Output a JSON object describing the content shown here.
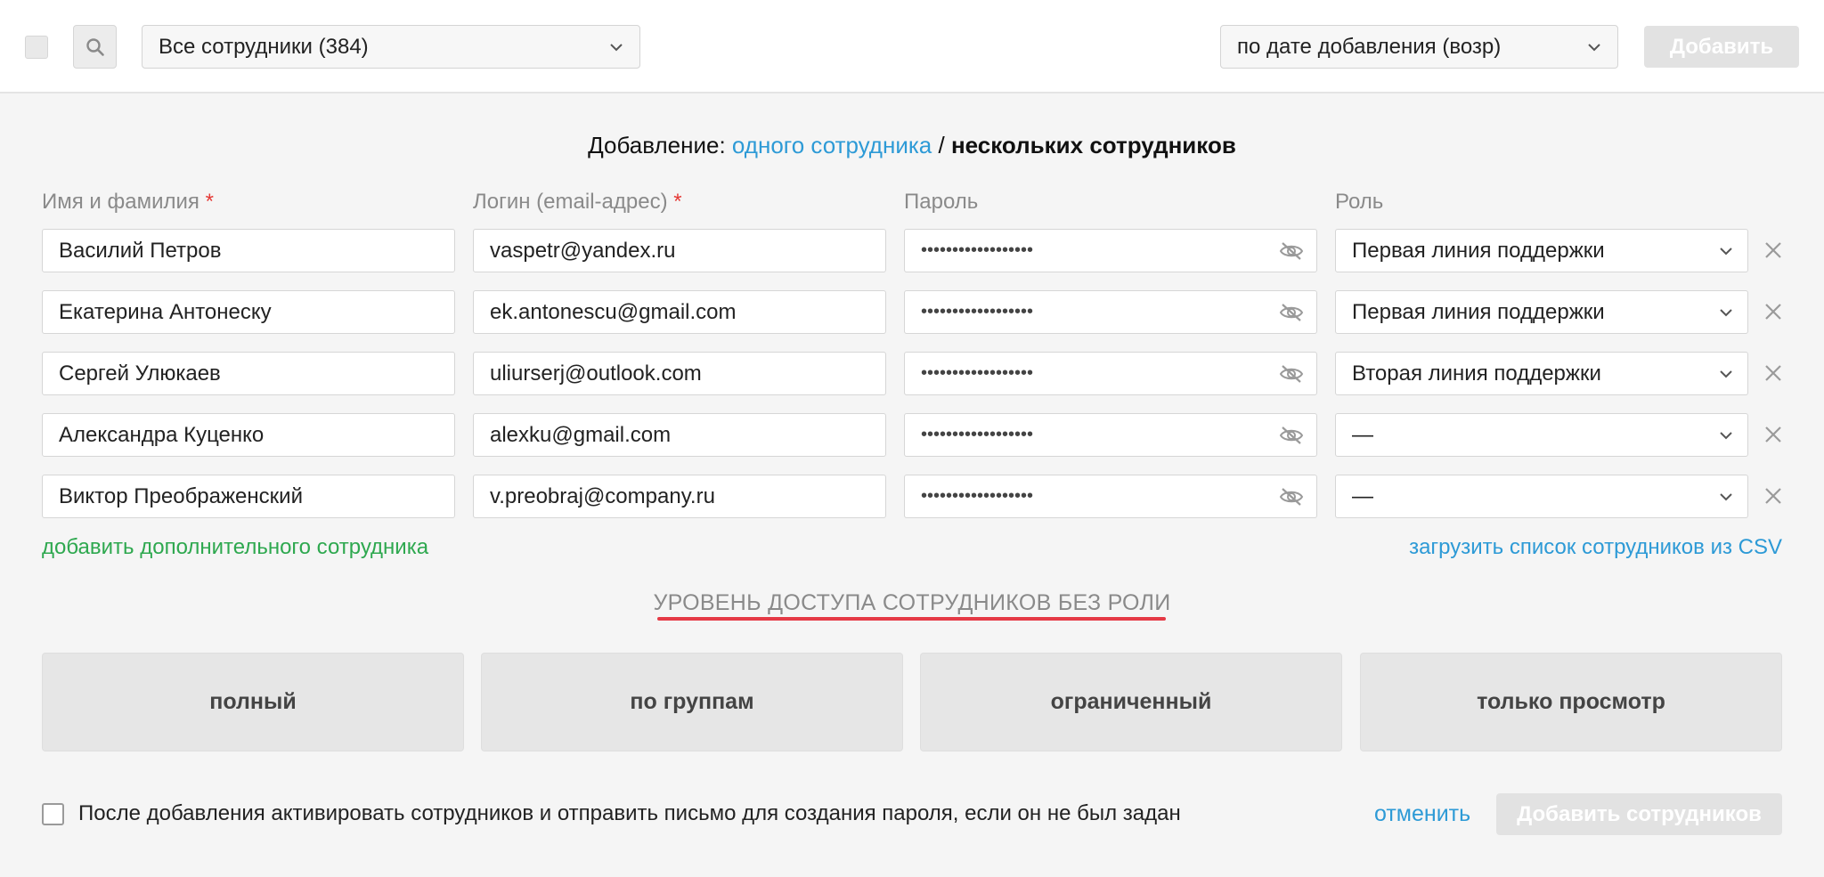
{
  "toolbar": {
    "filter_value": "Все сотрудники (384)",
    "sort_value": "по дате добавления (возр)",
    "add_label": "Добавить"
  },
  "form": {
    "heading_prefix": "Добавление:",
    "heading_single_link": "одного сотрудника",
    "heading_separator": "/",
    "heading_multi": "нескольких сотрудников",
    "columns": {
      "name": "Имя и фамилия",
      "login": "Логин (email-адрес)",
      "password": "Пароль",
      "role": "Роль",
      "required_mark": "*"
    },
    "rows": [
      {
        "name": "Василий Петров",
        "login": "vaspetr@yandex.ru",
        "password": "••••••••••••••••••",
        "role": "Первая линия поддержки"
      },
      {
        "name": "Екатерина Антонеску",
        "login": "ek.antonescu@gmail.com",
        "password": "••••••••••••••••••",
        "role": "Первая линия поддержки"
      },
      {
        "name": "Сергей Улюкаев",
        "login": "uliurserj@outlook.com",
        "password": "••••••••••••••••••",
        "role": "Вторая линия поддержки"
      },
      {
        "name": "Александра Куценко",
        "login": "alexku@gmail.com",
        "password": "••••••••••••••••••",
        "role": "—"
      },
      {
        "name": "Виктор Преображенский",
        "login": "v.preobraj@company.ru",
        "password": "••••••••••••••••••",
        "role": "—"
      }
    ],
    "add_more_link": "добавить дополнительного сотрудника",
    "csv_link": "загрузить список сотрудников из CSV"
  },
  "access": {
    "title": "УРОВЕНЬ ДОСТУПА СОТРУДНИКОВ БЕЗ РОЛИ",
    "options": [
      "полный",
      "по группам",
      "ограниченный",
      "только просмотр"
    ]
  },
  "footer": {
    "activate_label": "После добавления активировать сотрудников и отправить письмо для создания пароля, если он не был задан",
    "cancel_label": "отменить",
    "submit_label": "Добавить сотрудников"
  },
  "icons": {
    "search": "search-icon",
    "chevron": "chevron-down-icon",
    "eye": "eye-off-icon",
    "close": "close-icon"
  },
  "colors": {
    "link_blue": "#2d9ad6",
    "link_green": "#2ea84f",
    "required_red": "#e53935",
    "underline_red": "#e53945"
  }
}
